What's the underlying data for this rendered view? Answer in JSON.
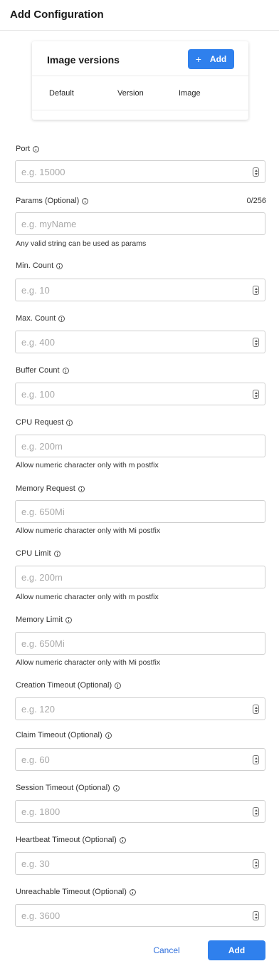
{
  "header": {
    "title": "Add Configuration"
  },
  "image_versions": {
    "title": "Image versions",
    "add_label": "Add",
    "columns": [
      "Default",
      "Version",
      "Image"
    ]
  },
  "fields": {
    "port": {
      "label": "Port",
      "placeholder": "e.g. 15000"
    },
    "params": {
      "label": "Params (Optional)",
      "counter": "0/256",
      "placeholder": "e.g. myName",
      "hint": "Any valid string can be used as params"
    },
    "min_count": {
      "label": "Min. Count",
      "placeholder": "e.g. 10"
    },
    "max_count": {
      "label": "Max. Count",
      "placeholder": "e.g. 400"
    },
    "buffer_count": {
      "label": "Buffer Count",
      "placeholder": "e.g. 100"
    },
    "cpu_request": {
      "label": "CPU Request",
      "placeholder": "e.g. 200m",
      "hint": "Allow numeric character only with m postfix"
    },
    "memory_request": {
      "label": "Memory Request",
      "placeholder": "e.g. 650Mi",
      "hint": "Allow numeric character only with Mi postfix"
    },
    "cpu_limit": {
      "label": "CPU Limit",
      "placeholder": "e.g. 200m",
      "hint": "Allow numeric character only with m postfix"
    },
    "memory_limit": {
      "label": "Memory Limit",
      "placeholder": "e.g. 650Mi",
      "hint": "Allow numeric character only with Mi postfix"
    },
    "creation_timeout": {
      "label": "Creation Timeout (Optional)",
      "placeholder": "e.g. 120"
    },
    "claim_timeout": {
      "label": "Claim Timeout (Optional)",
      "placeholder": "e.g. 60"
    },
    "session_timeout": {
      "label": "Session Timeout (Optional)",
      "placeholder": "e.g. 1800"
    },
    "heartbeat_timeout": {
      "label": "Heartbeat Timeout (Optional)",
      "placeholder": "e.g. 30"
    },
    "unreachable_timeout": {
      "label": "Unreachable Timeout (Optional)",
      "placeholder": "e.g. 3600"
    }
  },
  "footer": {
    "cancel_label": "Cancel",
    "submit_label": "Add"
  },
  "colors": {
    "primary": "#2f80ed",
    "link": "#2f6fdc"
  }
}
